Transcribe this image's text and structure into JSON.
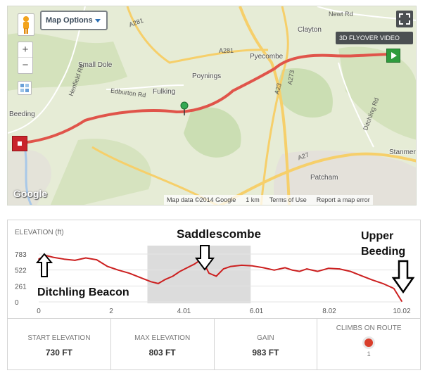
{
  "map": {
    "options_label": "Map Options",
    "flyover_label": "3D FLYOVER VIDEO",
    "zoom_in": "+",
    "zoom_out": "−",
    "google": "Google",
    "attribution": {
      "map_data": "Map data ©2014 Google",
      "scale": "1 km",
      "terms": "Terms of Use",
      "report": "Report a map error"
    },
    "places": [
      "Small Dole",
      "Fulking",
      "Poynings",
      "Pyecombe",
      "Clayton",
      "Beeding",
      "Patcham",
      "Stanmer"
    ],
    "roads": [
      "A281",
      "Henfield Rd",
      "Edburton Rd",
      "A281",
      "A23",
      "A273",
      "Ditchling Rd",
      "A27",
      "Newt Rd"
    ]
  },
  "elevation": {
    "title": "ELEVATION (ft)",
    "y_ticks": [
      "783",
      "522",
      "261",
      "0"
    ],
    "x_ticks": [
      "0",
      "2",
      "4.01",
      "6.01",
      "8.02",
      "10.02"
    ],
    "annotations": {
      "start": "Ditchling Beacon",
      "mid": "Saddlescombe",
      "end_line1": "Upper",
      "end_line2": "Beeding"
    }
  },
  "chart_data": {
    "type": "area",
    "title": "",
    "xlabel": "",
    "ylabel": "ELEVATION (ft)",
    "xlim": [
      0,
      10.02
    ],
    "ylim": [
      0,
      783
    ],
    "x": [
      0,
      0.2,
      0.4,
      0.7,
      1.0,
      1.3,
      1.6,
      1.9,
      2.2,
      2.5,
      2.8,
      3.1,
      3.3,
      3.5,
      3.7,
      3.9,
      4.1,
      4.3,
      4.5,
      4.7,
      4.9,
      5.1,
      5.3,
      5.6,
      5.9,
      6.2,
      6.5,
      6.8,
      7.0,
      7.2,
      7.4,
      7.7,
      8.0,
      8.3,
      8.6,
      8.9,
      9.2,
      9.5,
      9.8,
      10.02
    ],
    "y": [
      700,
      760,
      730,
      700,
      680,
      720,
      690,
      580,
      520,
      470,
      400,
      330,
      300,
      370,
      420,
      500,
      560,
      620,
      700,
      470,
      420,
      540,
      580,
      600,
      590,
      560,
      520,
      560,
      520,
      500,
      540,
      500,
      550,
      540,
      500,
      430,
      360,
      300,
      220,
      10
    ]
  },
  "stats": [
    {
      "label": "START ELEVATION",
      "value": "730 FT"
    },
    {
      "label": "MAX ELEVATION",
      "value": "803 FT"
    },
    {
      "label": "GAIN",
      "value": "983 FT"
    },
    {
      "label": "CLIMBS ON ROUTE",
      "value": "1"
    }
  ],
  "colors": {
    "route": "#e0544a",
    "elevation_line": "#cc2020",
    "highlight": "#d0d0d0"
  }
}
